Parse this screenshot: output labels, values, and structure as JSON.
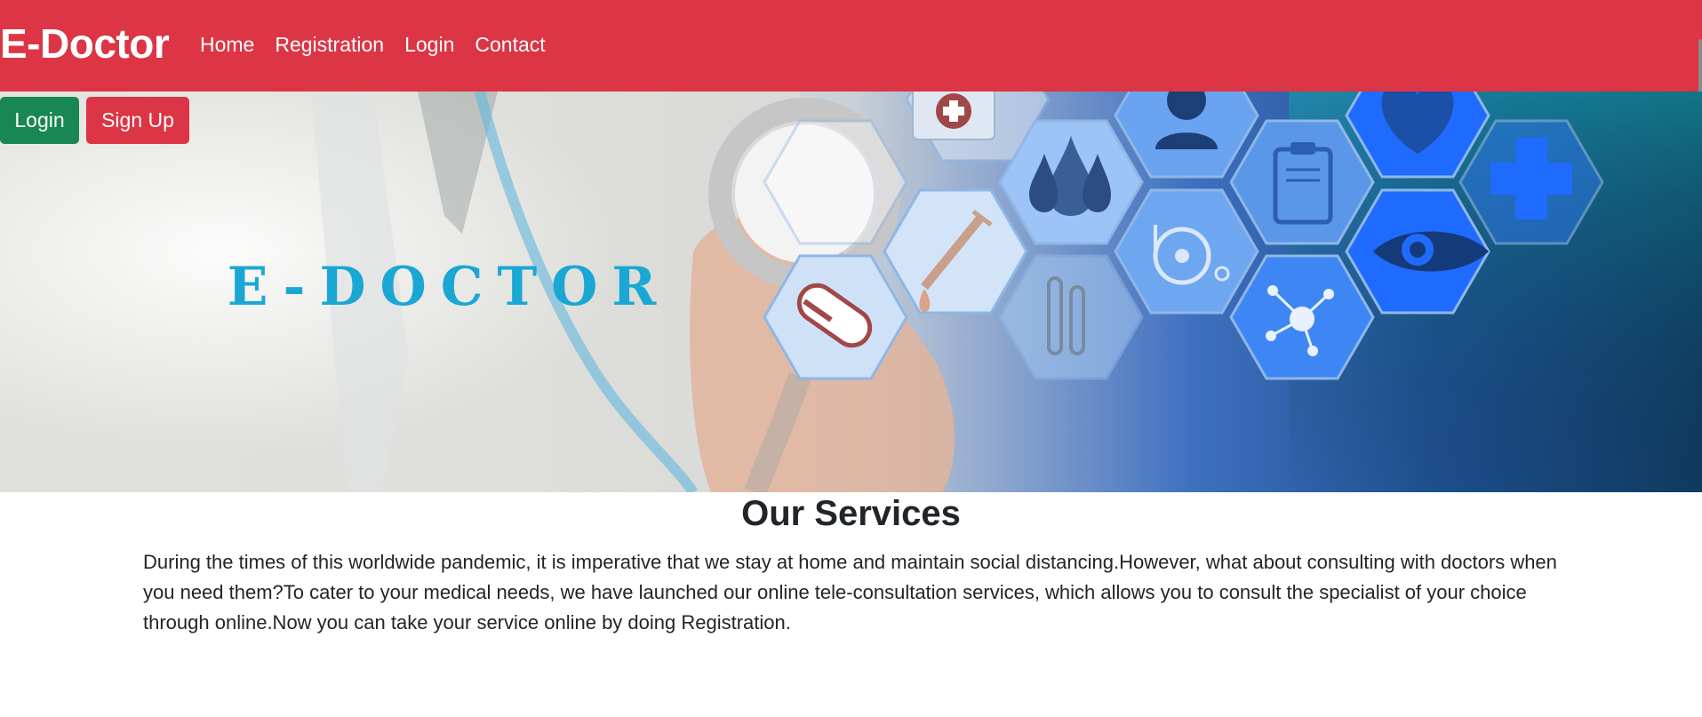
{
  "navbar": {
    "brand": "E-Doctor",
    "links": [
      "Home",
      "Registration",
      "Login",
      "Contact"
    ]
  },
  "hero": {
    "logo_text": "E-DOCTOR",
    "buttons": {
      "login": "Login",
      "signup": "Sign Up"
    },
    "icons": [
      "first-aid-kit-icon",
      "doctor-icon",
      "heart-icon",
      "blood-drops-icon",
      "clipboard-icon",
      "medical-cross-icon",
      "syringe-icon",
      "wheelchair-icon",
      "eye-icon",
      "pill-capsule-icon",
      "test-tubes-icon",
      "molecule-icon",
      "stethoscope-icon"
    ]
  },
  "services": {
    "title": "Our Services",
    "description": "During the times of this worldwide pandemic, it is imperative that we stay at home and maintain social distancing.However, what about consulting with doctors when you need them?To cater to your medical needs, we have launched our online tele-consultation services, which allows you to consult the specialist of your choice through online.Now you can take your service online by doing Registration."
  },
  "colors": {
    "navbar": "#dc3545",
    "login_button": "#198754",
    "signup_button": "#dc3545",
    "logo_text": "#1aa7d4",
    "hex_blue": "#1f6bff"
  }
}
